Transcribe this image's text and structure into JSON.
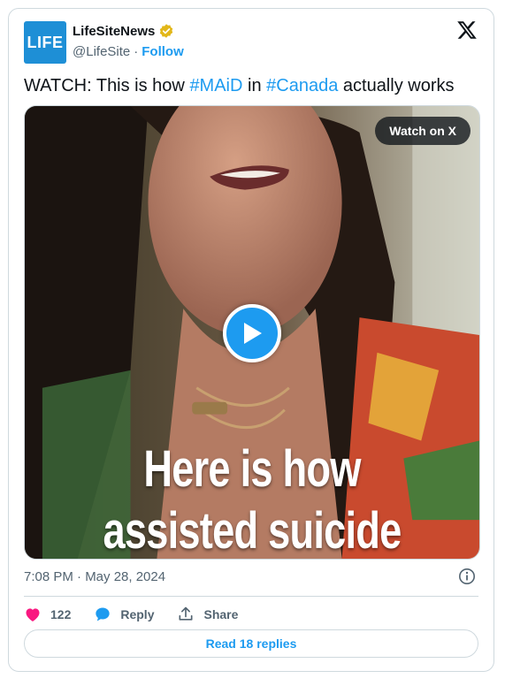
{
  "author": {
    "avatar_text": "LIFE",
    "display_name": "LifeSiteNews",
    "handle": "@LifeSite",
    "separator": "·",
    "follow_label": "Follow"
  },
  "tweet": {
    "text_prefix": "WATCH: This is how ",
    "hashtag1": "#MAiD",
    "text_middle": " in ",
    "hashtag2": "#Canada",
    "text_suffix": " actually works"
  },
  "media": {
    "watch_label": "Watch on X",
    "caption_line1": "Here is how",
    "caption_line2": "assisted suicide"
  },
  "meta": {
    "timestamp": "7:08 PM · May 28, 2024"
  },
  "actions": {
    "like_count": "122",
    "reply_label": "Reply",
    "share_label": "Share",
    "read_replies_label": "Read 18 replies"
  },
  "colors": {
    "accent": "#1d9bf0",
    "like": "#f91880",
    "verified": "#e2b719"
  },
  "icons": [
    "verified-badge-icon",
    "x-logo-icon",
    "play-icon",
    "info-icon",
    "heart-icon",
    "reply-bubble-icon",
    "share-icon"
  ]
}
